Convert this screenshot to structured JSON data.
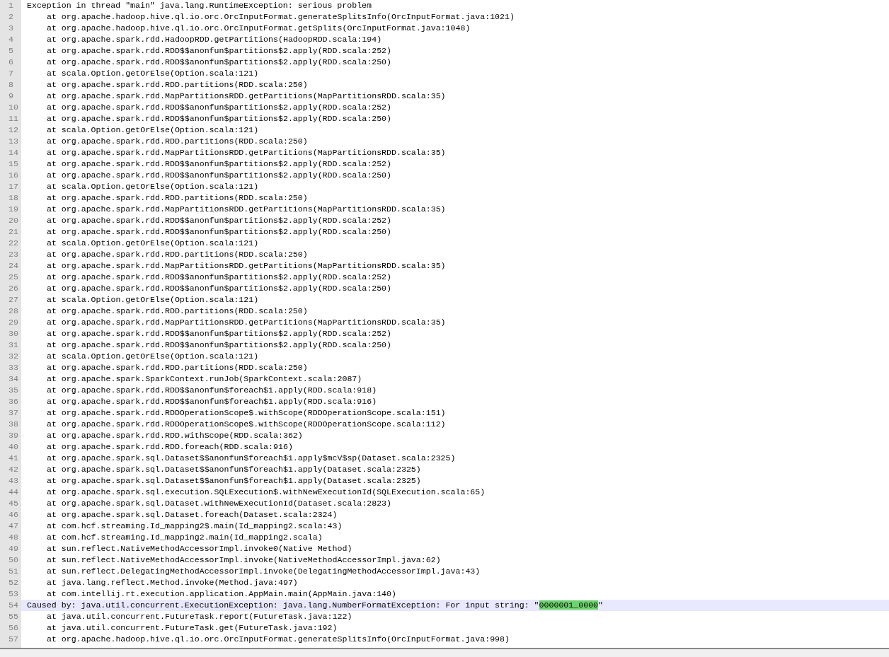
{
  "editor": {
    "lines": [
      {
        "number": "1",
        "indented": false,
        "selected": false,
        "text": "Exception in thread \"main\" java.lang.RuntimeException: serious problem"
      },
      {
        "number": "2",
        "indented": true,
        "selected": false,
        "text": "at org.apache.hadoop.hive.ql.io.orc.OrcInputFormat.generateSplitsInfo(OrcInputFormat.java:1021)"
      },
      {
        "number": "3",
        "indented": true,
        "selected": false,
        "text": "at org.apache.hadoop.hive.ql.io.orc.OrcInputFormat.getSplits(OrcInputFormat.java:1048)"
      },
      {
        "number": "4",
        "indented": true,
        "selected": false,
        "text": "at org.apache.spark.rdd.HadoopRDD.getPartitions(HadoopRDD.scala:194)"
      },
      {
        "number": "5",
        "indented": true,
        "selected": false,
        "text": "at org.apache.spark.rdd.RDD$$anonfun$partitions$2.apply(RDD.scala:252)"
      },
      {
        "number": "6",
        "indented": true,
        "selected": false,
        "text": "at org.apache.spark.rdd.RDD$$anonfun$partitions$2.apply(RDD.scala:250)"
      },
      {
        "number": "7",
        "indented": true,
        "selected": false,
        "text": "at scala.Option.getOrElse(Option.scala:121)"
      },
      {
        "number": "8",
        "indented": true,
        "selected": false,
        "text": "at org.apache.spark.rdd.RDD.partitions(RDD.scala:250)"
      },
      {
        "number": "9",
        "indented": true,
        "selected": false,
        "text": "at org.apache.spark.rdd.MapPartitionsRDD.getPartitions(MapPartitionsRDD.scala:35)"
      },
      {
        "number": "10",
        "indented": true,
        "selected": false,
        "text": "at org.apache.spark.rdd.RDD$$anonfun$partitions$2.apply(RDD.scala:252)"
      },
      {
        "number": "11",
        "indented": true,
        "selected": false,
        "text": "at org.apache.spark.rdd.RDD$$anonfun$partitions$2.apply(RDD.scala:250)"
      },
      {
        "number": "12",
        "indented": true,
        "selected": false,
        "text": "at scala.Option.getOrElse(Option.scala:121)"
      },
      {
        "number": "13",
        "indented": true,
        "selected": false,
        "text": "at org.apache.spark.rdd.RDD.partitions(RDD.scala:250)"
      },
      {
        "number": "14",
        "indented": true,
        "selected": false,
        "text": "at org.apache.spark.rdd.MapPartitionsRDD.getPartitions(MapPartitionsRDD.scala:35)"
      },
      {
        "number": "15",
        "indented": true,
        "selected": false,
        "text": "at org.apache.spark.rdd.RDD$$anonfun$partitions$2.apply(RDD.scala:252)"
      },
      {
        "number": "16",
        "indented": true,
        "selected": false,
        "text": "at org.apache.spark.rdd.RDD$$anonfun$partitions$2.apply(RDD.scala:250)"
      },
      {
        "number": "17",
        "indented": true,
        "selected": false,
        "text": "at scala.Option.getOrElse(Option.scala:121)"
      },
      {
        "number": "18",
        "indented": true,
        "selected": false,
        "text": "at org.apache.spark.rdd.RDD.partitions(RDD.scala:250)"
      },
      {
        "number": "19",
        "indented": true,
        "selected": false,
        "text": "at org.apache.spark.rdd.MapPartitionsRDD.getPartitions(MapPartitionsRDD.scala:35)"
      },
      {
        "number": "20",
        "indented": true,
        "selected": false,
        "text": "at org.apache.spark.rdd.RDD$$anonfun$partitions$2.apply(RDD.scala:252)"
      },
      {
        "number": "21",
        "indented": true,
        "selected": false,
        "text": "at org.apache.spark.rdd.RDD$$anonfun$partitions$2.apply(RDD.scala:250)"
      },
      {
        "number": "22",
        "indented": true,
        "selected": false,
        "text": "at scala.Option.getOrElse(Option.scala:121)"
      },
      {
        "number": "23",
        "indented": true,
        "selected": false,
        "text": "at org.apache.spark.rdd.RDD.partitions(RDD.scala:250)"
      },
      {
        "number": "24",
        "indented": true,
        "selected": false,
        "text": "at org.apache.spark.rdd.MapPartitionsRDD.getPartitions(MapPartitionsRDD.scala:35)"
      },
      {
        "number": "25",
        "indented": true,
        "selected": false,
        "text": "at org.apache.spark.rdd.RDD$$anonfun$partitions$2.apply(RDD.scala:252)"
      },
      {
        "number": "26",
        "indented": true,
        "selected": false,
        "text": "at org.apache.spark.rdd.RDD$$anonfun$partitions$2.apply(RDD.scala:250)"
      },
      {
        "number": "27",
        "indented": true,
        "selected": false,
        "text": "at scala.Option.getOrElse(Option.scala:121)"
      },
      {
        "number": "28",
        "indented": true,
        "selected": false,
        "text": "at org.apache.spark.rdd.RDD.partitions(RDD.scala:250)"
      },
      {
        "number": "29",
        "indented": true,
        "selected": false,
        "text": "at org.apache.spark.rdd.MapPartitionsRDD.getPartitions(MapPartitionsRDD.scala:35)"
      },
      {
        "number": "30",
        "indented": true,
        "selected": false,
        "text": "at org.apache.spark.rdd.RDD$$anonfun$partitions$2.apply(RDD.scala:252)"
      },
      {
        "number": "31",
        "indented": true,
        "selected": false,
        "text": "at org.apache.spark.rdd.RDD$$anonfun$partitions$2.apply(RDD.scala:250)"
      },
      {
        "number": "32",
        "indented": true,
        "selected": false,
        "text": "at scala.Option.getOrElse(Option.scala:121)"
      },
      {
        "number": "33",
        "indented": true,
        "selected": false,
        "text": "at org.apache.spark.rdd.RDD.partitions(RDD.scala:250)"
      },
      {
        "number": "34",
        "indented": true,
        "selected": false,
        "text": "at org.apache.spark.SparkContext.runJob(SparkContext.scala:2087)"
      },
      {
        "number": "35",
        "indented": true,
        "selected": false,
        "text": "at org.apache.spark.rdd.RDD$$anonfun$foreach$1.apply(RDD.scala:918)"
      },
      {
        "number": "36",
        "indented": true,
        "selected": false,
        "text": "at org.apache.spark.rdd.RDD$$anonfun$foreach$1.apply(RDD.scala:916)"
      },
      {
        "number": "37",
        "indented": true,
        "selected": false,
        "text": "at org.apache.spark.rdd.RDDOperationScope$.withScope(RDDOperationScope.scala:151)"
      },
      {
        "number": "38",
        "indented": true,
        "selected": false,
        "text": "at org.apache.spark.rdd.RDDOperationScope$.withScope(RDDOperationScope.scala:112)"
      },
      {
        "number": "39",
        "indented": true,
        "selected": false,
        "text": "at org.apache.spark.rdd.RDD.withScope(RDD.scala:362)"
      },
      {
        "number": "40",
        "indented": true,
        "selected": false,
        "text": "at org.apache.spark.rdd.RDD.foreach(RDD.scala:916)"
      },
      {
        "number": "41",
        "indented": true,
        "selected": false,
        "text": "at org.apache.spark.sql.Dataset$$anonfun$foreach$1.apply$mcV$sp(Dataset.scala:2325)"
      },
      {
        "number": "42",
        "indented": true,
        "selected": false,
        "text": "at org.apache.spark.sql.Dataset$$anonfun$foreach$1.apply(Dataset.scala:2325)"
      },
      {
        "number": "43",
        "indented": true,
        "selected": false,
        "text": "at org.apache.spark.sql.Dataset$$anonfun$foreach$1.apply(Dataset.scala:2325)"
      },
      {
        "number": "44",
        "indented": true,
        "selected": false,
        "text": "at org.apache.spark.sql.execution.SQLExecution$.withNewExecutionId(SQLExecution.scala:65)"
      },
      {
        "number": "45",
        "indented": true,
        "selected": false,
        "text": "at org.apache.spark.sql.Dataset.withNewExecutionId(Dataset.scala:2823)"
      },
      {
        "number": "46",
        "indented": true,
        "selected": false,
        "text": "at org.apache.spark.sql.Dataset.foreach(Dataset.scala:2324)"
      },
      {
        "number": "47",
        "indented": true,
        "selected": false,
        "text": "at com.hcf.streaming.Id_mapping2$.main(Id_mapping2.scala:43)"
      },
      {
        "number": "48",
        "indented": true,
        "selected": false,
        "text": "at com.hcf.streaming.Id_mapping2.main(Id_mapping2.scala)"
      },
      {
        "number": "49",
        "indented": true,
        "selected": false,
        "text": "at sun.reflect.NativeMethodAccessorImpl.invoke0(Native Method)"
      },
      {
        "number": "50",
        "indented": true,
        "selected": false,
        "text": "at sun.reflect.NativeMethodAccessorImpl.invoke(NativeMethodAccessorImpl.java:62)"
      },
      {
        "number": "51",
        "indented": true,
        "selected": false,
        "text": "at sun.reflect.DelegatingMethodAccessorImpl.invoke(DelegatingMethodAccessorImpl.java:43)"
      },
      {
        "number": "52",
        "indented": true,
        "selected": false,
        "text": "at java.lang.reflect.Method.invoke(Method.java:497)"
      },
      {
        "number": "53",
        "indented": true,
        "selected": false,
        "text": "at com.intellij.rt.execution.application.AppMain.main(AppMain.java:140)"
      },
      {
        "number": "54",
        "indented": false,
        "selected": true,
        "text": "Caused by: java.util.concurrent.ExecutionException: java.lang.NumberFormatException: For input string: \"",
        "match": "0000001_0000",
        "after": "\""
      },
      {
        "number": "55",
        "indented": true,
        "selected": false,
        "text": "at java.util.concurrent.FutureTask.report(FutureTask.java:122)"
      },
      {
        "number": "56",
        "indented": true,
        "selected": false,
        "text": "at java.util.concurrent.FutureTask.get(FutureTask.java:192)"
      },
      {
        "number": "57",
        "indented": true,
        "selected": false,
        "text": "at org.apache.hadoop.hive.ql.io.orc.OrcInputFormat.generateSplitsInfo(OrcInputFormat.java:998)"
      }
    ]
  }
}
